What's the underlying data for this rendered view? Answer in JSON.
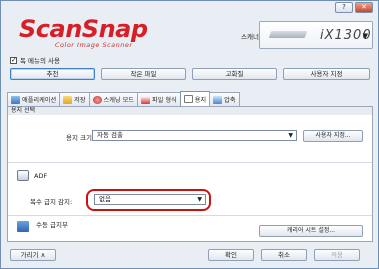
{
  "app": {
    "logo": "ScanSnap",
    "logo_sub": "Color Image Scanner",
    "help_btn": "?",
    "close_btn": "✕"
  },
  "scanner": {
    "label": "스캐너",
    "model": "iX1300"
  },
  "show_menu": {
    "label": "독 메뉴의 사용",
    "checked": true
  },
  "profiles": [
    "추천",
    "작은 파일",
    "고화질",
    "사용자 지정"
  ],
  "tabs": [
    {
      "label": "애플리케이션",
      "icon": "application-icon"
    },
    {
      "label": "저장",
      "icon": "folder-icon"
    },
    {
      "label": "스캐닝 모드",
      "icon": "scan-mode-icon"
    },
    {
      "label": "파일 형식",
      "icon": "file-format-icon"
    },
    {
      "label": "용지",
      "icon": "paper-icon"
    },
    {
      "label": "압축",
      "icon": "compression-icon"
    }
  ],
  "paper": {
    "section_title": "용지 선택",
    "size_label": "용지 크기:",
    "size_value": "자동 검출",
    "custom_btn": "사용자 지정...",
    "adf_label": "ADF",
    "multifeed_label": "복수 급지 감지:",
    "multifeed_value": "없음",
    "manual_label": "수동 급지부",
    "carrier_btn": "캐리어 시트 설정..."
  },
  "footer": {
    "hide_btn": "가리기",
    "ok_btn": "확인",
    "cancel_btn": "취소",
    "apply_btn": "적용"
  }
}
